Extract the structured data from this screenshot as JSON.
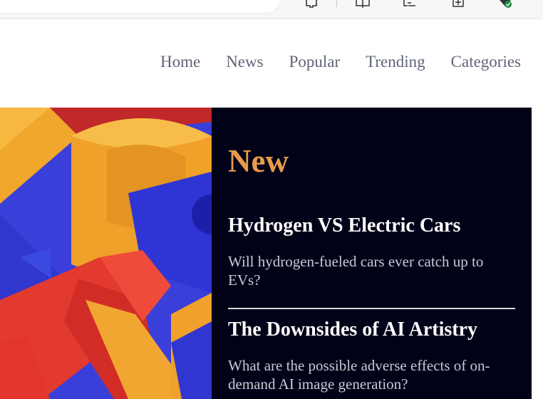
{
  "nav": {
    "items": [
      "Home",
      "News",
      "Popular",
      "Trending",
      "Categories"
    ]
  },
  "new_section": {
    "heading": "New",
    "articles": [
      {
        "title": "Hydrogen VS Electric Cars",
        "summary": "Will hydrogen-fueled cars ever catch up to EVs?"
      },
      {
        "title": "The Downsides of AI Artistry",
        "summary": "What are the possible adverse effects of on-demand AI image generation?"
      }
    ]
  },
  "colors": {
    "panel_bg": "#010118",
    "accent": "#e69c4b",
    "nav_text": "#5f6478"
  },
  "icons": [
    "read-aloud-icon",
    "favorite-star-icon",
    "extensions-icon",
    "split-screen-icon",
    "favorites-icon",
    "collections-icon",
    "browser-essentials-icon"
  ]
}
